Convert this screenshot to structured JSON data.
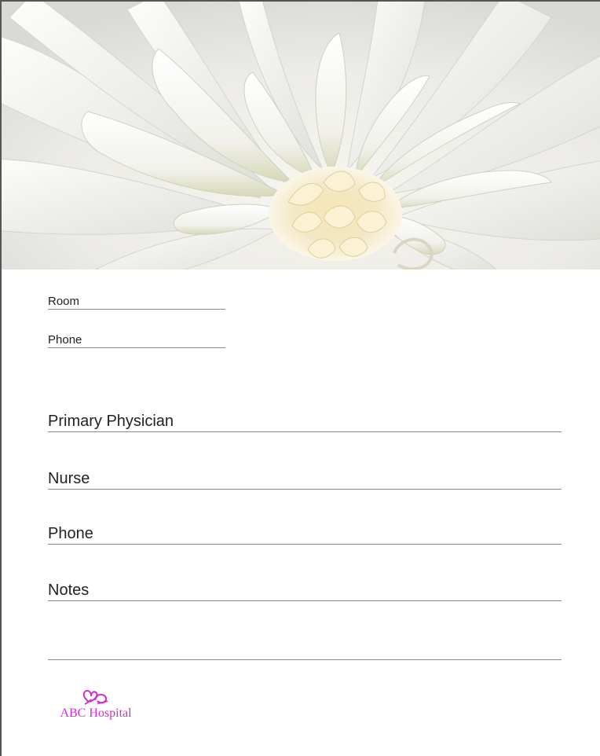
{
  "fields_small": [
    {
      "label": "Room"
    },
    {
      "label": "Phone"
    }
  ],
  "fields_large": [
    {
      "label": "Primary Physician"
    },
    {
      "label": "Nurse"
    },
    {
      "label": "Phone"
    },
    {
      "label": "Notes"
    }
  ],
  "logo": {
    "name": "ABC Hospital",
    "color": "#d52bd0",
    "icon": "butterfly-heart-icon"
  },
  "hero_image": {
    "icon": "white-dahlia-flower"
  }
}
